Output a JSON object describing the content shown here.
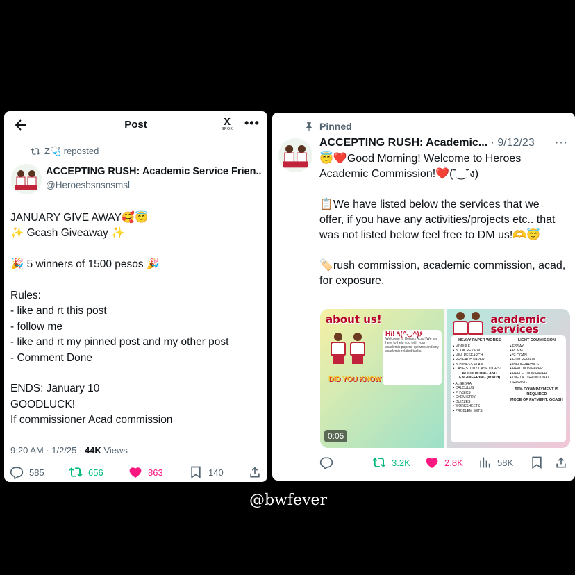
{
  "left_post": {
    "header_title": "Post",
    "grok_mark": "X",
    "grok_label": "GROK",
    "more": "•••",
    "reposted_by": "Z🩺 reposted",
    "display_name": "ACCEPTING RUSH: Academic Service Frien...",
    "handle": "@Heroesbsnsnsmsl",
    "body": "JANUARY GIVE AWAY🥰😇\n✨ Gcash Giveaway ✨\n\n🎉 5 winners of 1500 pesos 🎉\n\nRules:\n- like and rt this post\n- follow me\n- like and rt my pinned post and my other post\n- Comment Done\n\nENDS: January 10\nGOODLUCK!\nIf commissioner  Acad commission",
    "timestamp": "9:20 AM · 1/2/25 · ",
    "views_count": "44K",
    "views_label": " Views",
    "replies": "585",
    "reposts": "656",
    "likes": "863",
    "bookmarks": "140"
  },
  "right_post": {
    "pinned_label": "Pinned",
    "display_name": "ACCEPTING RUSH: Academic...",
    "date": " · 9/12/23",
    "more": "···",
    "body": "😇❤️Good Morning! Welcome to Heroes Academic Commission!❤️(˘‿˘ง)\n\n📋We have listed below the services that we offer, if you have any activities/projects etc.. that was not listed below feel free to DM us!🫶😇\n\n🏷️rush commission, academic commission, acad, for exposure.",
    "media": {
      "about_title": "about us!",
      "hi_text": "Hi! ٩(^◡^)۶",
      "about_body": "Welcome to Heroes Acad! We are here to help you with your academic papers, quizzes and any academic related tasks.",
      "did_you_know": "DID YOU KNOW",
      "services_title": "academic services",
      "col1_head": "HEAVY PAPER WORKS",
      "col1_items": [
        "• MODULE",
        "• BOOK REVIEW",
        "• MINI RESEARCH",
        "• RESEACH PAPER",
        "• BUSINESS PLAN",
        "• CASE STUDY/CASE DIGEST",
        "ACCOUNTING AND ENGINEERING (MATH)",
        "• ALGEBRA",
        "• CALCULUS",
        "• PHYSICS",
        "• CHEMISTRY",
        "• QUIZZES",
        "• WORKSHEETS",
        "• PROBLEM SETS"
      ],
      "col2_head": "LIGHT COMMISSION",
      "col2_items": [
        "• ESSAY",
        "• POEM",
        "• SLOGAN",
        "• FILM REVIEW",
        "• INFOGRAPHICS",
        "• REACTION PAPER",
        "• REFLECTION PAPER",
        "• DIGITAL/TRADITIONAL DRAWING",
        "50% DOWNPAYMENT IS REQUIRED",
        "MODE OF PAYMENT: GCASH"
      ],
      "video_time": "0:05"
    },
    "replies": "",
    "reposts": "3.2K",
    "likes": "2.8K",
    "views": "58K"
  },
  "watermark": "@bwfever",
  "colors": {
    "repost_green": "#00ba7c",
    "like_pink": "#f91880",
    "muted": "#536471"
  }
}
